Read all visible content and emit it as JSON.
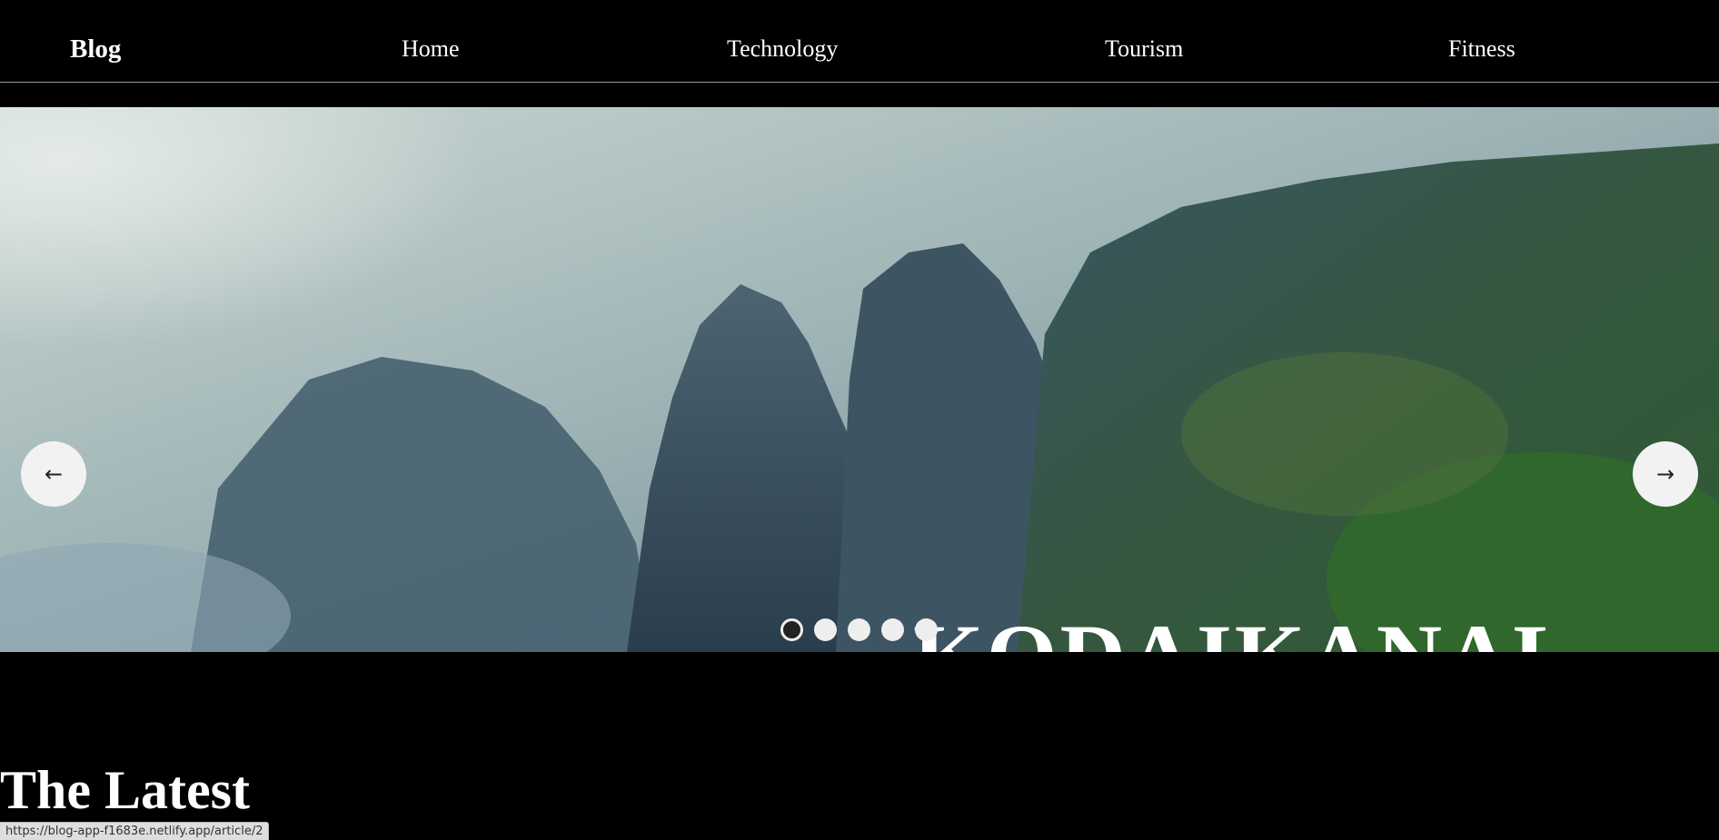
{
  "header": {
    "brand": "Blog",
    "nav": [
      "Home",
      "Technology",
      "Tourism",
      "Fitness"
    ]
  },
  "hero": {
    "title": "KODAIKANAL",
    "prev_icon": "arrow-left-icon",
    "next_icon": "arrow-right-icon",
    "slide_count": 5,
    "active_slide": 1
  },
  "section": {
    "heading": "The Latest"
  },
  "status_bar": {
    "url": "https://blog-app-f1683e.netlify.app/article/2"
  },
  "colors": {
    "background": "#000000",
    "text": "#ffffff",
    "arrow_bg": "#f2f2f2"
  }
}
